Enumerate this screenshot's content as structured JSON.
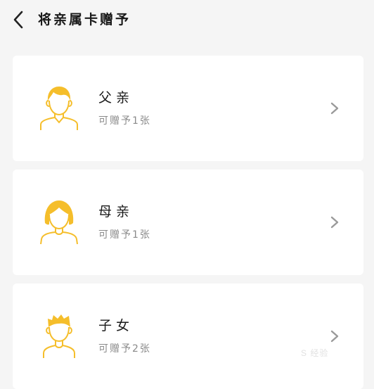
{
  "header": {
    "title": "将亲属卡赠予",
    "back_icon": "chevron-left-icon"
  },
  "colors": {
    "accent": "#F5BE2B",
    "background": "#F5F5F5",
    "card": "#FFFFFF",
    "subtext": "#8A8A8A"
  },
  "cards": [
    {
      "name": "父亲",
      "sub": "可赠予1张",
      "icon": "father-avatar-icon"
    },
    {
      "name": "母亲",
      "sub": "可赠予1张",
      "icon": "mother-avatar-icon"
    },
    {
      "name": "子女",
      "sub": "可赠予2张",
      "icon": "child-avatar-icon"
    }
  ],
  "watermark": "S 经验"
}
